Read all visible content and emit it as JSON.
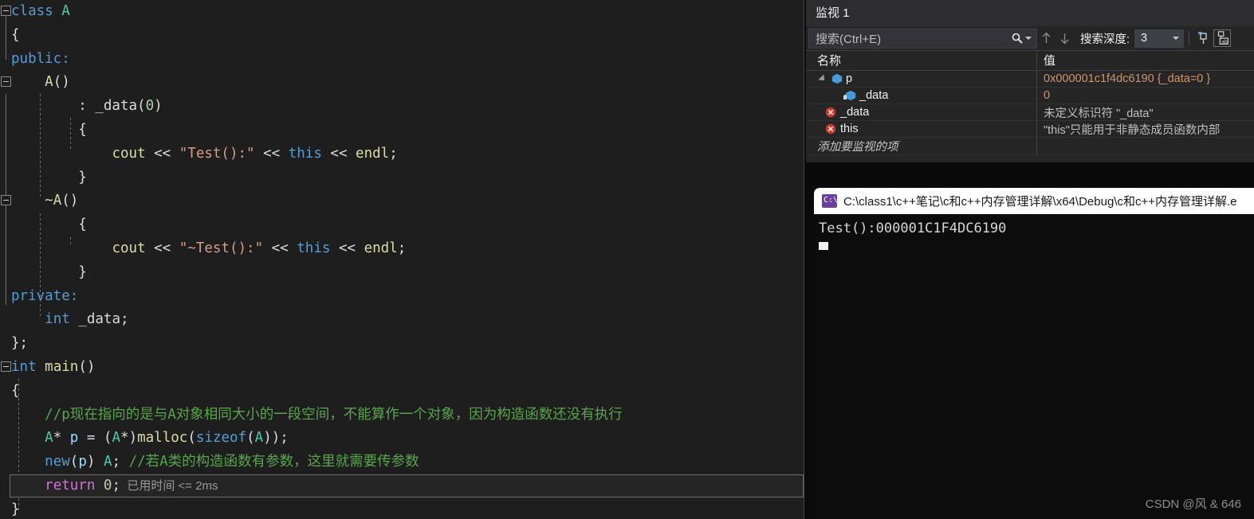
{
  "editor": {
    "lines": [
      {
        "indent_guides": [],
        "collapse": true,
        "segments": [
          {
            "t": "class ",
            "c": "k"
          },
          {
            "t": "A",
            "c": "cls"
          }
        ]
      },
      {
        "segments": [
          {
            "t": "{",
            "c": "op"
          }
        ]
      },
      {
        "segments": [
          {
            "t": "public:",
            "c": "k"
          }
        ]
      },
      {
        "collapse": true,
        "segments": [
          {
            "t": "    ",
            "c": "op"
          },
          {
            "t": "A",
            "c": "fn"
          },
          {
            "t": "()",
            "c": "op"
          }
        ]
      },
      {
        "segments": [
          {
            "t": "        : ",
            "c": "op"
          },
          {
            "t": "_data",
            "c": "id"
          },
          {
            "t": "(",
            "c": "op"
          },
          {
            "t": "0",
            "c": "num"
          },
          {
            "t": ")",
            "c": "op"
          }
        ]
      },
      {
        "segments": [
          {
            "t": "        {",
            "c": "op"
          }
        ]
      },
      {
        "segments": [
          {
            "t": "            ",
            "c": "op"
          },
          {
            "t": "cout",
            "c": "fn"
          },
          {
            "t": " << ",
            "c": "op"
          },
          {
            "t": "\"Test():\"",
            "c": "str"
          },
          {
            "t": " << ",
            "c": "op"
          },
          {
            "t": "this",
            "c": "k"
          },
          {
            "t": " << ",
            "c": "op"
          },
          {
            "t": "endl",
            "c": "fn"
          },
          {
            "t": ";",
            "c": "op"
          }
        ]
      },
      {
        "segments": [
          {
            "t": "        }",
            "c": "op"
          }
        ]
      },
      {
        "collapse": true,
        "segments": [
          {
            "t": "    ",
            "c": "op"
          },
          {
            "t": "~A",
            "c": "fn"
          },
          {
            "t": "()",
            "c": "op"
          }
        ]
      },
      {
        "segments": [
          {
            "t": "        {",
            "c": "op"
          }
        ]
      },
      {
        "segments": [
          {
            "t": "            ",
            "c": "op"
          },
          {
            "t": "cout",
            "c": "fn"
          },
          {
            "t": " << ",
            "c": "op"
          },
          {
            "t": "\"~Test():\"",
            "c": "str"
          },
          {
            "t": " << ",
            "c": "op"
          },
          {
            "t": "this",
            "c": "k"
          },
          {
            "t": " << ",
            "c": "op"
          },
          {
            "t": "endl",
            "c": "fn"
          },
          {
            "t": ";",
            "c": "op"
          }
        ]
      },
      {
        "segments": [
          {
            "t": "        }",
            "c": "op"
          }
        ]
      },
      {
        "segments": [
          {
            "t": "private:",
            "c": "k"
          }
        ]
      },
      {
        "segments": [
          {
            "t": "    ",
            "c": "op"
          },
          {
            "t": "int",
            "c": "k"
          },
          {
            "t": " _data;",
            "c": "id"
          }
        ]
      },
      {
        "segments": [
          {
            "t": "};",
            "c": "op"
          }
        ]
      },
      {
        "collapse": true,
        "segments": [
          {
            "t": "int",
            "c": "k"
          },
          {
            "t": " ",
            "c": "op"
          },
          {
            "t": "main",
            "c": "fn"
          },
          {
            "t": "()",
            "c": "op"
          }
        ]
      },
      {
        "segments": [
          {
            "t": "{",
            "c": "op"
          }
        ]
      },
      {
        "segments": [
          {
            "t": "    ",
            "c": "op"
          },
          {
            "t": "//p现在指向的是与A对象相同大小的一段空间，不能算作一个对象，因为构造函数还没有执行",
            "c": "com"
          }
        ]
      },
      {
        "segments": [
          {
            "t": "    ",
            "c": "op"
          },
          {
            "t": "A",
            "c": "cls"
          },
          {
            "t": "* ",
            "c": "op"
          },
          {
            "t": "p",
            "c": "loc"
          },
          {
            "t": " = (",
            "c": "op"
          },
          {
            "t": "A",
            "c": "cls"
          },
          {
            "t": "*)",
            "c": "op"
          },
          {
            "t": "malloc",
            "c": "fn"
          },
          {
            "t": "(",
            "c": "op"
          },
          {
            "t": "sizeof",
            "c": "k"
          },
          {
            "t": "(",
            "c": "op"
          },
          {
            "t": "A",
            "c": "cls"
          },
          {
            "t": "));",
            "c": "op"
          }
        ]
      },
      {
        "segments": [
          {
            "t": "    ",
            "c": "op"
          },
          {
            "t": "new",
            "c": "k"
          },
          {
            "t": "(",
            "c": "op"
          },
          {
            "t": "p",
            "c": "loc"
          },
          {
            "t": ") ",
            "c": "op"
          },
          {
            "t": "A",
            "c": "cls"
          },
          {
            "t": "; ",
            "c": "op"
          },
          {
            "t": "//若A类的构造函数有参数，这里就需要传参数",
            "c": "com"
          }
        ]
      },
      {
        "current": true,
        "segments": [
          {
            "t": "    ",
            "c": "op"
          },
          {
            "t": "return",
            "c": "kmag"
          },
          {
            "t": " ",
            "c": "op"
          },
          {
            "t": "0",
            "c": "num"
          },
          {
            "t": ";",
            "c": "op"
          }
        ],
        "perf_tip": "已用时间 <= 2ms"
      },
      {
        "segments": [
          {
            "t": "}",
            "c": "op"
          }
        ]
      }
    ]
  },
  "watch": {
    "title": "监视 1",
    "search": {
      "placeholder": "搜索(Ctrl+E)",
      "icon": "search-icon"
    },
    "nav_up_icon": "arrow-up-icon",
    "nav_down_icon": "arrow-down-icon",
    "depth_label": "搜索深度:",
    "depth_value": "3",
    "pin_icon": "pin-icon",
    "pin_ab_icon": "pin-ab-icon",
    "columns": {
      "name": "名称",
      "value": "值"
    },
    "rows": [
      {
        "name": "p",
        "value": "0x000001c1f4dc6190 {_data=0 }",
        "icon": "object-box-icon",
        "expanded": true,
        "indent": 0,
        "error": false
      },
      {
        "name": "_data",
        "value": "0",
        "icon": "field-lock-box-icon",
        "expanded": false,
        "indent": 2,
        "error": false
      },
      {
        "name": "_data",
        "value": "未定义标识符 \"_data\"",
        "icon": "error-x-icon",
        "expanded": false,
        "indent": 1,
        "error": true
      },
      {
        "name": "this",
        "value": "\"this\"只能用于非静态成员函数内部",
        "icon": "error-x-icon",
        "expanded": false,
        "indent": 1,
        "error": true
      }
    ],
    "add_item_placeholder": "添加要监视的项"
  },
  "console": {
    "icon": "cmd-window-icon",
    "title": "C:\\class1\\c++笔记\\c和c++内存管理详解\\x64\\Debug\\c和c++内存管理详解.e",
    "output": "Test():000001C1F4DC6190"
  },
  "watermark": "CSDN @风 & 646",
  "colors": {
    "editor_bg": "#1e1e1e",
    "panel_bg": "#252526",
    "keyword": "#569cd6",
    "keyword_magenta": "#d670d6",
    "type": "#4ec9b0",
    "function": "#dcdcaa",
    "string": "#d69d85",
    "number": "#b5cea8",
    "comment": "#57a64a",
    "value_orange": "#d0956b",
    "console_bg": "#0c0c0c"
  }
}
